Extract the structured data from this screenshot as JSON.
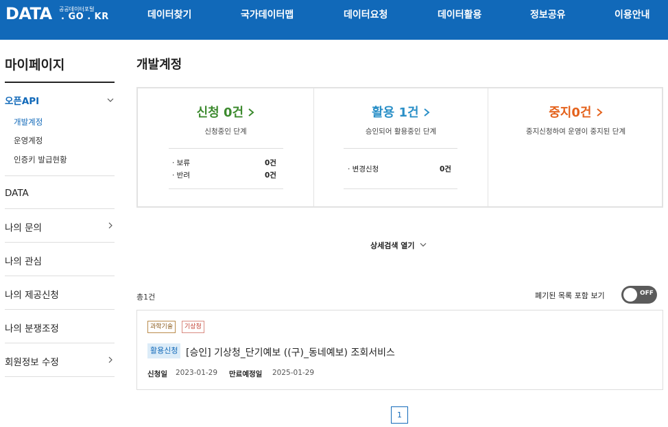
{
  "header": {
    "logo_main": "DATA",
    "logo_small": "공공데이터포털",
    "logo_sub": ". GO . KR",
    "nav": [
      "데이터찾기",
      "국가데이터맵",
      "데이터요청",
      "데이터활용",
      "정보공유",
      "이용안내"
    ]
  },
  "sidebar": {
    "title": "마이페이지",
    "group": "오픈API",
    "subitems": [
      "개발계정",
      "운영계정",
      "인증키 발급현황"
    ],
    "menus": [
      "DATA",
      "나의 문의",
      "나의 관심",
      "나의 제공신청",
      "나의 분쟁조정",
      "회원정보 수정"
    ]
  },
  "main": {
    "title": "개발계정",
    "status": [
      {
        "label": "신청 0건",
        "color": "#3c8a2e",
        "desc": "신청중인 단계",
        "rows": [
          {
            "label": "· 보류",
            "value": "0건"
          },
          {
            "label": "· 반려",
            "value": "0건"
          }
        ]
      },
      {
        "label": "활용 1건",
        "color": "#2a8fc7",
        "desc": "승인되어 활용중인 단계",
        "rows": [
          {
            "label": "· 변경신청",
            "value": "0건"
          }
        ]
      },
      {
        "label": "중지0건",
        "color": "#e4621c",
        "desc": "중지신청하여 운영이 중지된 단계",
        "rows": []
      }
    ],
    "detail_search": "상세검색 열기",
    "total": "총1건",
    "toggle_label": "폐기된 목록 포함 보기",
    "toggle_state": "OFF",
    "card": {
      "tags": [
        "과학기술",
        "기상청"
      ],
      "badge": "활용신청",
      "title": "[승인] 기상청_단기예보 ((구)_동네예보) 조회서비스",
      "apply_label": "신청일",
      "apply_date": "2023-01-29",
      "expire_label": "만료예정일",
      "expire_date": "2025-01-29"
    },
    "pagination": [
      "1"
    ]
  }
}
